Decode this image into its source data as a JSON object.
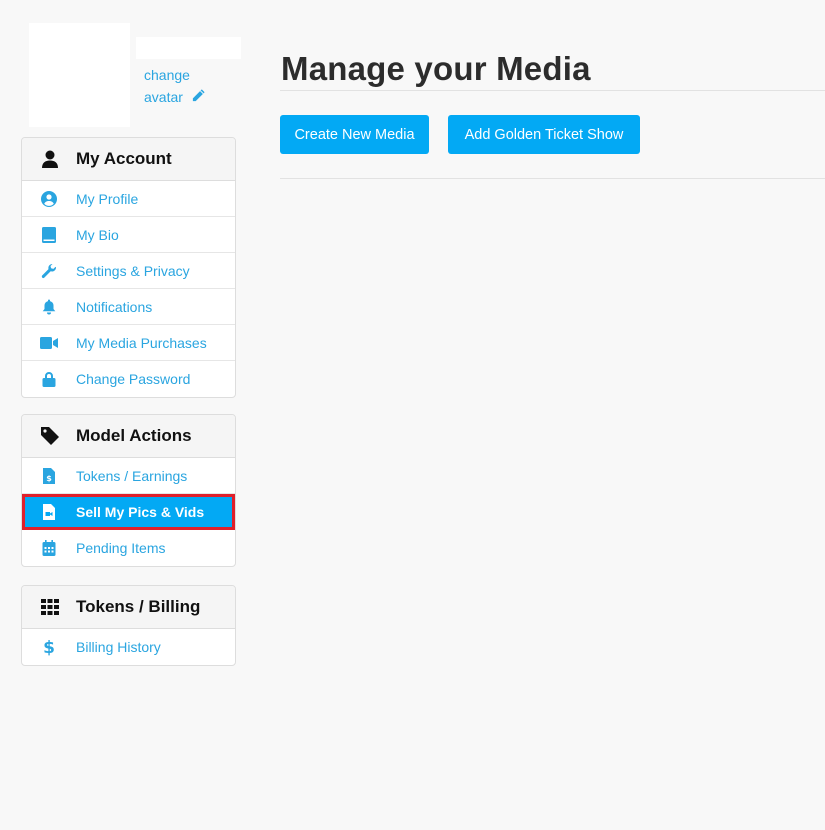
{
  "profile": {
    "change_avatar_line1": "change",
    "change_avatar_line2": "avatar",
    "avatar_edit_icon": "pencil-icon"
  },
  "sidebar": {
    "panels": [
      {
        "title": "My Account",
        "icon": "user-icon",
        "items": [
          {
            "label": "My Profile",
            "icon": "user-circle-icon"
          },
          {
            "label": "My Bio",
            "icon": "book-icon"
          },
          {
            "label": "Settings & Privacy",
            "icon": "wrench-icon"
          },
          {
            "label": "Notifications",
            "icon": "bell-icon"
          },
          {
            "label": "My Media Purchases",
            "icon": "video-camera-icon"
          },
          {
            "label": "Change Password",
            "icon": "lock-icon"
          }
        ]
      },
      {
        "title": "Model Actions",
        "icon": "tag-icon",
        "items": [
          {
            "label": "Tokens / Earnings",
            "icon": "invoice-dollar-icon"
          },
          {
            "label": "Sell My Pics & Vids",
            "icon": "file-video-icon",
            "active": true
          },
          {
            "label": "Pending Items",
            "icon": "calendar-icon"
          }
        ]
      },
      {
        "title": "Tokens / Billing",
        "icon": "grid-icon",
        "items": [
          {
            "label": "Billing History",
            "icon": "dollar-icon"
          }
        ]
      }
    ]
  },
  "main": {
    "title": "Manage your Media",
    "buttons": {
      "create_new_media": "Create New Media",
      "add_golden_ticket_show": "Add Golden Ticket Show"
    }
  },
  "colors": {
    "accent": "#03a9f4",
    "link": "#2aa5e0",
    "highlight_border": "#e0202b",
    "background": "#f8f8f8"
  }
}
